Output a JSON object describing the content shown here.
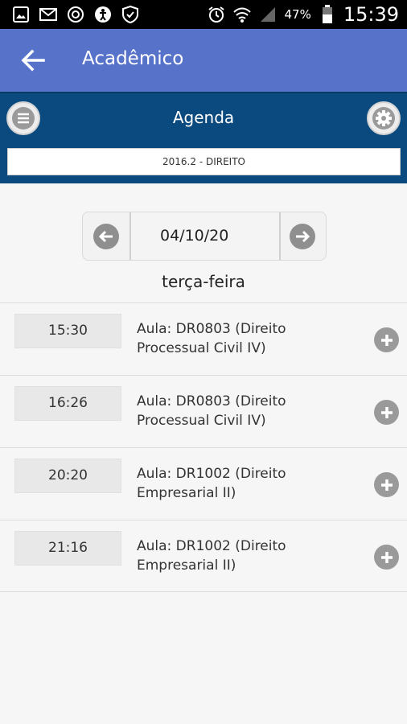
{
  "status_bar": {
    "battery_percent": "47%",
    "time": "15:39",
    "icons_left": [
      "gallery-icon",
      "mail-icon",
      "sync-icon",
      "accessibility-icon",
      "shield-icon"
    ],
    "icons_right": [
      "alarm-icon",
      "wifi-icon",
      "signal-icon",
      "battery-icon"
    ]
  },
  "appbar": {
    "title": "Acadêmico"
  },
  "agenda": {
    "title": "Agenda",
    "course": "2016.2 - DIREITO"
  },
  "date_nav": {
    "date_value": "04/10/20",
    "weekday": "terça-feira"
  },
  "events": [
    {
      "time": "15:30",
      "line1": "Aula: DR0803 (Direito",
      "line2": "Processual Civil IV)"
    },
    {
      "time": "16:26",
      "line1": "Aula: DR0803 (Direito",
      "line2": "Processual Civil IV)"
    },
    {
      "time": "20:20",
      "line1": "Aula: DR1002 (Direito",
      "line2": "Empresarial II)"
    },
    {
      "time": "21:16",
      "line1": "Aula: DR1002 (Direito",
      "line2": "Empresarial II)"
    }
  ],
  "colors": {
    "appbar": "#5773c9",
    "agendabar": "#0b4a7f",
    "background": "#f6f6f6"
  }
}
